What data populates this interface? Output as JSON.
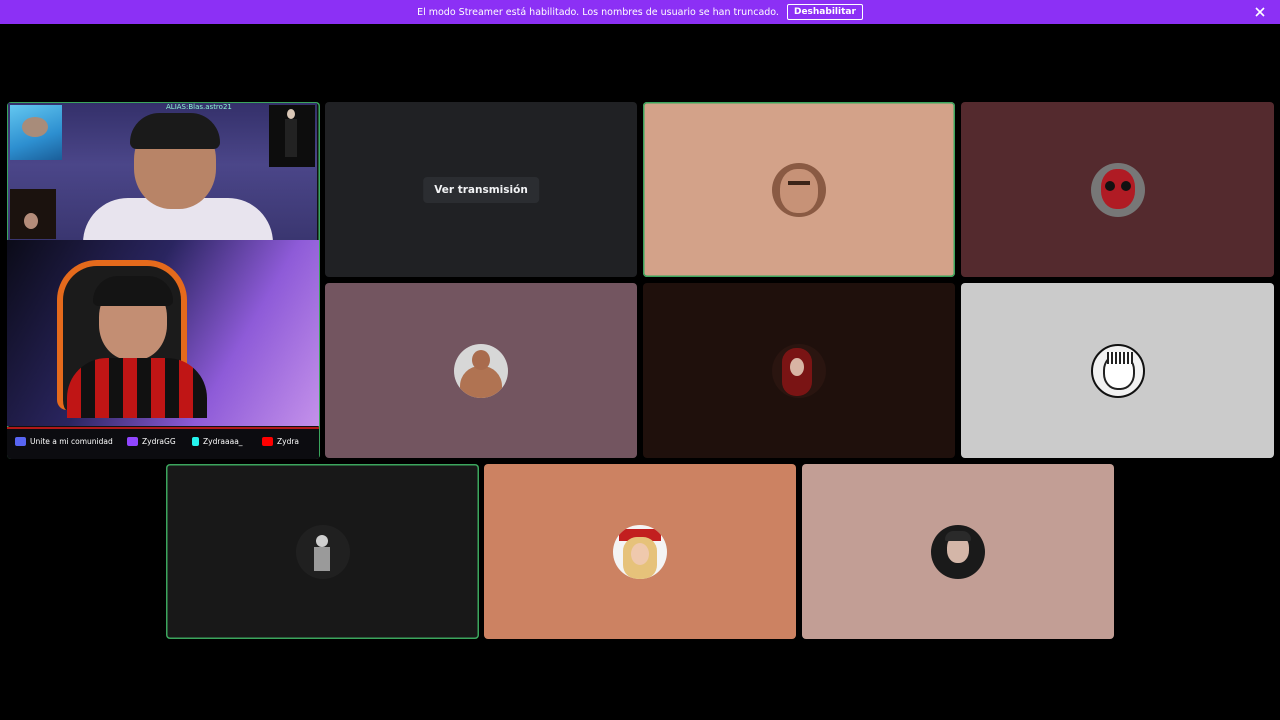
{
  "banner": {
    "text": "El modo Streamer está habilitado. Los nombres de usuario se han truncado.",
    "button_label": "Deshabilitar",
    "color": "#8c30f5"
  },
  "stream": {
    "overlay_alias": "ALIAS:Blas.astro21",
    "socials": [
      {
        "icon": "discord-icon",
        "label": "Unite a mi comunidad"
      },
      {
        "icon": "twitch-icon",
        "label": "ZydraGG"
      },
      {
        "icon": "tiktok-icon",
        "label": "Zydraaaa_"
      },
      {
        "icon": "youtube-icon",
        "label": "Zydra"
      }
    ]
  },
  "watch_stream": {
    "label": "Ver transmisión"
  },
  "participants": [
    {
      "bg": "#d3a289",
      "speaking": true,
      "avatar": "face-avatar"
    },
    {
      "bg": "#542a2e",
      "speaking": false,
      "avatar": "spiderman-avatar"
    },
    {
      "bg": "#735560",
      "speaking": false,
      "avatar": "bodybuilder-avatar"
    },
    {
      "bg": "#1f100c",
      "speaking": false,
      "avatar": "redhair-avatar"
    },
    {
      "bg": "#cbcbcb",
      "speaking": false,
      "avatar": "manga-avatar"
    },
    {
      "bg": "#181818",
      "speaking": true,
      "avatar": "bw-figure-avatar"
    },
    {
      "bg": "#cc8262",
      "speaking": false,
      "avatar": "blonde-avatar"
    },
    {
      "bg": "#c29e95",
      "speaking": false,
      "avatar": "man-avatar"
    }
  ],
  "colors": {
    "speaking_ring": "#3ba55d",
    "background": "#000000"
  }
}
